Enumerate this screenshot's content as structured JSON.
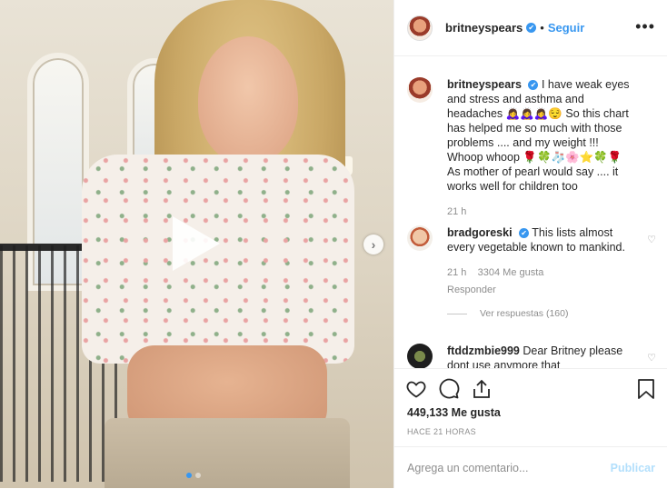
{
  "post": {
    "username": "britneyspears",
    "verified_badge": "✔",
    "separator": "•",
    "follow_label": "Seguir",
    "more_label": "•••"
  },
  "comments": [
    {
      "username": "britneyspears",
      "text": "I have weak eyes and stress and asthma and headaches 🙇‍♀️🙇‍♀️🙇‍♀️😌 So this chart has helped me so much with those problems .... and my weight !!! Whoop whoop 🌹🍀🧦🌸⭐🍀🌹 As mother of pearl would say .... it works well for children too",
      "time": "21 h"
    },
    {
      "username": "bradgoreski",
      "text": "This lists almost every vegetable known to mankind.",
      "time": "21 h",
      "likes": "3304 Me gusta",
      "reply_label": "Responder",
      "view_replies": "Ver respuestas (160)"
    },
    {
      "username": "ftddzmbie999",
      "text": "Dear Britney please dont use anymore that"
    }
  ],
  "actions": {
    "like_count": "449,133 Me gusta",
    "timestamp": "HACE 21 HORAS"
  },
  "add_comment": {
    "placeholder": "Agrega un comentario...",
    "publish_label": "Publicar"
  },
  "colors": {
    "accent": "#3897f0",
    "publish_disabled": "#b2dffc",
    "muted": "#8e8e8e"
  }
}
